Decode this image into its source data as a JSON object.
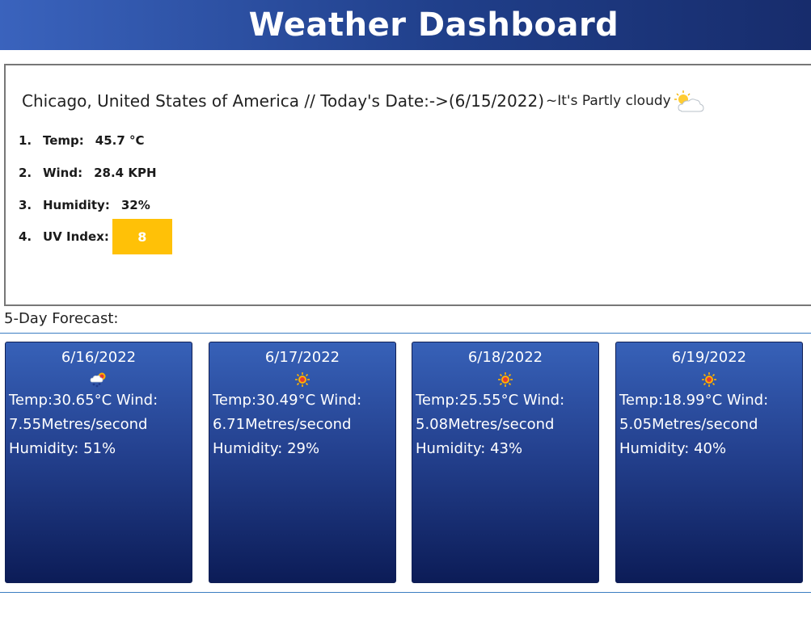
{
  "header": {
    "title": "Weather Dashboard"
  },
  "current": {
    "city_line": "Chicago, United States of America // Today's Date:->(6/15/2022)",
    "condition": "~It's Partly cloudy",
    "condition_icon": "partly-cloudy-icon",
    "stats": [
      {
        "num": "1.",
        "label": "Temp:",
        "value": "45.7 °C"
      },
      {
        "num": "2.",
        "label": "Wind:",
        "value": "28.4 KPH"
      },
      {
        "num": "3.",
        "label": "Humidity:",
        "value": "32%"
      },
      {
        "num": "4.",
        "label": "UV Index:",
        "value": "8"
      }
    ],
    "uv_color": "#ffc107"
  },
  "forecast": {
    "title": "5-Day Forecast:",
    "days": [
      {
        "date": "6/16/2022",
        "icon": "rain-sun-icon",
        "temp": "Temp:30.65°C",
        "wind_label": "Wind:",
        "wind": "7.55Metres/second",
        "humidity": "Humidity: 51%"
      },
      {
        "date": "6/17/2022",
        "icon": "sun-icon",
        "temp": "Temp:30.49°C",
        "wind_label": "Wind:",
        "wind": "6.71Metres/second",
        "humidity": "Humidity: 29%"
      },
      {
        "date": "6/18/2022",
        "icon": "sun-icon",
        "temp": "Temp:25.55°C",
        "wind_label": "Wind:",
        "wind": "5.08Metres/second",
        "humidity": "Humidity: 43%"
      },
      {
        "date": "6/19/2022",
        "icon": "sun-icon",
        "temp": "Temp:18.99°C",
        "wind_label": "Wind:",
        "wind": "5.05Metres/second",
        "humidity": "Humidity: 40%"
      }
    ]
  },
  "colors": {
    "header_start": "#3a63bd",
    "header_end": "#172c6c",
    "card_top": "#3761b8",
    "card_bottom": "#0c1c57",
    "rule": "#3b7ec2"
  }
}
